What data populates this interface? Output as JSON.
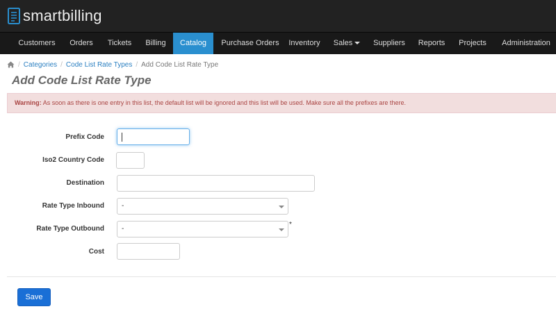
{
  "app": {
    "name": "smartbilling"
  },
  "nav": {
    "items": [
      {
        "label": "Customers"
      },
      {
        "label": "Orders"
      },
      {
        "label": "Tickets"
      },
      {
        "label": "Billing"
      },
      {
        "label": "Catalog"
      },
      {
        "label": "Purchase Orders"
      },
      {
        "label": "Inventory"
      },
      {
        "label": "Sales"
      },
      {
        "label": "Suppliers"
      },
      {
        "label": "Reports"
      },
      {
        "label": "Projects"
      },
      {
        "label": "Administration"
      }
    ],
    "active": "Catalog",
    "active_color": "#2a8fcf"
  },
  "breadcrumb": {
    "home_icon": "home-icon",
    "items": [
      "Categories",
      "Code List Rate Types"
    ],
    "current": "Add Code List Rate Type",
    "separator": "/"
  },
  "page": {
    "title": "Add Code List Rate Type"
  },
  "alert": {
    "strong": "Warning:",
    "text": "As soon as there is one entry in this list, the default list will be ignored and this list will be used. Make sure all the prefixes are there."
  },
  "form": {
    "prefix_code": {
      "label": "Prefix Code",
      "value": ""
    },
    "iso2_country_code": {
      "label": "Iso2 Country Code",
      "value": ""
    },
    "destination": {
      "label": "Destination",
      "value": ""
    },
    "rate_type_inbound": {
      "label": "Rate Type Inbound",
      "selected": "-"
    },
    "rate_type_outbound": {
      "label": "Rate Type Outbound",
      "selected": "-",
      "required_mark": "*"
    },
    "cost": {
      "label": "Cost",
      "value": ""
    }
  },
  "actions": {
    "save_label": "Save",
    "save_color": "#1a6fd6"
  }
}
